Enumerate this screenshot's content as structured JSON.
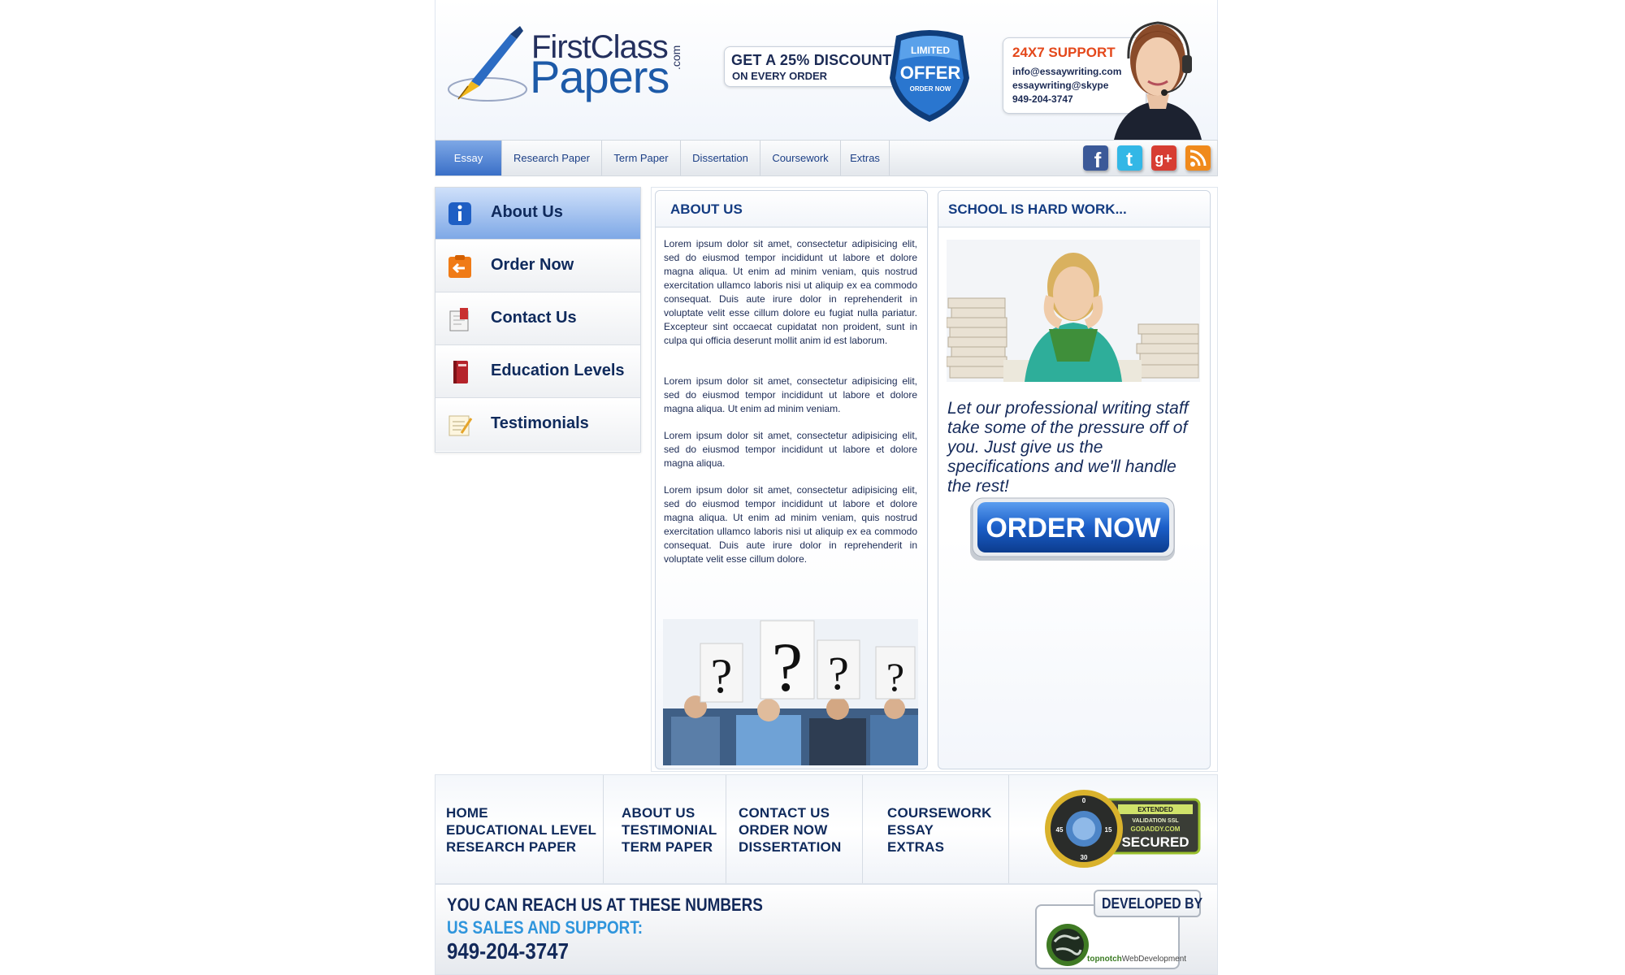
{
  "header": {
    "logo": {
      "line1": "FirstClass",
      "line2": "Papers",
      "suffix": ".com"
    },
    "promo": {
      "line1": "GET A 25% DISCOUNT",
      "line2": "ON EVERY ORDER"
    },
    "offer_badge": {
      "line1": "LIMITED",
      "line2": "OFFER",
      "line3": "ORDER NOW"
    },
    "support": {
      "title": "24X7 SUPPORT",
      "email": "info@essaywriting.com",
      "skype": "essaywriting@skype",
      "phone": "949-204-3747"
    }
  },
  "nav": {
    "tabs": [
      {
        "label": "Essay",
        "active": true
      },
      {
        "label": "Research Paper"
      },
      {
        "label": "Term Paper"
      },
      {
        "label": "Dissertation"
      },
      {
        "label": "Coursework"
      },
      {
        "label": "Extras"
      }
    ],
    "social": [
      "facebook-icon",
      "twitter-icon",
      "google-plus-icon",
      "rss-icon"
    ]
  },
  "sidebar": {
    "items": [
      {
        "label": "About Us",
        "icon": "info-icon",
        "active": true
      },
      {
        "label": "Order Now",
        "icon": "order-icon"
      },
      {
        "label": "Contact Us",
        "icon": "contact-icon"
      },
      {
        "label": "Education Levels",
        "icon": "book-icon"
      },
      {
        "label": "Testimonials",
        "icon": "notepad-icon"
      }
    ]
  },
  "about": {
    "title": "ABOUT US",
    "paragraphs": [
      "Lorem ipsum dolor sit amet, consectetur adipisicing elit, sed do eiusmod tempor incididunt ut labore et dolore magna aliqua. Ut enim ad minim veniam, quis nostrud exercitation ullamco laboris nisi ut aliquip ex ea commodo consequat. Duis aute irure dolor in reprehenderit in voluptate velit esse cillum dolore eu fugiat nulla pariatur. Excepteur sint occaecat cupidatat non proident, sunt in culpa qui officia deserunt mollit anim id est laborum.",
      "Lorem ipsum dolor sit amet, consectetur adipisicing elit, sed do eiusmod tempor incididunt ut labore et dolore magna aliqua. Ut enim ad minim veniam.",
      "Lorem ipsum dolor sit amet, consectetur adipisicing elit, sed do eiusmod tempor incididunt ut labore et dolore magna aliqua.",
      "Lorem ipsum dolor sit amet, consectetur adipisicing elit, sed do eiusmod tempor incididunt ut labore et dolore magna aliqua. Ut enim ad minim veniam, quis nostrud exercitation ullamco laboris nisi ut aliquip ex ea commodo consequat. Duis aute irure dolor in reprehenderit in voluptate velit esse cillum dolore."
    ]
  },
  "school": {
    "title": "SCHOOL IS HARD WORK...",
    "pitch": "Let our professional writing staff take some of the pressure off of you. Just give us the specifications and we'll handle the rest!",
    "order_button": "ORDER NOW"
  },
  "footer": {
    "link_columns": [
      [
        "HOME",
        "EDUCATIONAL LEVEL",
        "RESEARCH PAPER"
      ],
      [
        "ABOUT US",
        "TESTIMONIAL",
        "TERM PAPER"
      ],
      [
        "CONTACT US",
        "ORDER NOW",
        "DISSERTATION"
      ],
      [
        "COURSEWORK",
        "ESSAY",
        "EXTRAS"
      ]
    ],
    "ssl": {
      "line1": "EXTENDED",
      "line2": "VALIDATION SSL",
      "line3": "GODADDY.COM",
      "line4": "SECURED"
    },
    "reach_title": "YOU CAN REACH US AT THESE  NUMBERS",
    "sales_title": "US SALES AND SUPPORT:",
    "sales_phone": "949-204-3747",
    "developed_by": "DEVELOPED BY",
    "developer": {
      "name": "topnotch",
      "suffix": "WebDevelopment"
    }
  },
  "colors": {
    "brand_navy": "#0f2a5c",
    "brand_blue": "#1d5aa8",
    "accent_orange": "#e4481b",
    "sales_blue": "#2f95dc"
  }
}
